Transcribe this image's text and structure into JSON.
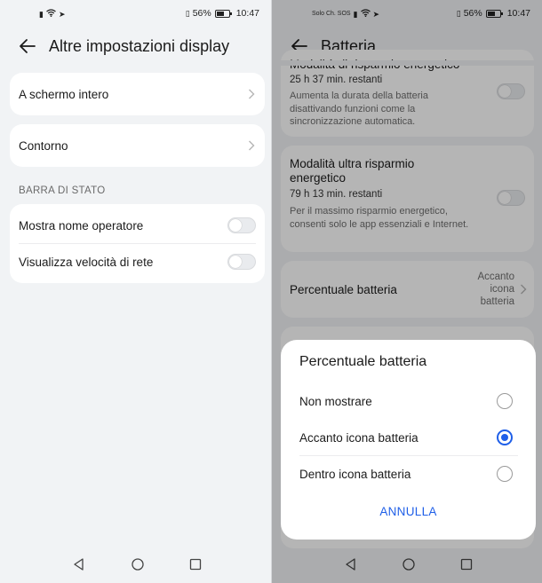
{
  "left": {
    "statusbar": {
      "battery": "56%",
      "time": "10:47"
    },
    "header": {
      "title": "Altre impostazioni display"
    },
    "items": [
      {
        "label": "A schermo intero"
      },
      {
        "label": "Contorno"
      }
    ],
    "section": {
      "title": "BARRA DI STATO"
    },
    "toggles": [
      {
        "label": "Mostra nome operatore",
        "on": false
      },
      {
        "label": "Visualizza velocità di rete",
        "on": false
      }
    ]
  },
  "right": {
    "statusbar": {
      "carrier": "Solo Ch. SOS",
      "battery": "56%",
      "time": "10:47"
    },
    "header": {
      "title": "Batteria"
    },
    "power_saving": {
      "title_partial": "Modalità di risparmio energetico",
      "remaining": "25 h 37 min. restanti",
      "description": "Aumenta la durata della batteria disattivando funzioni come la sincronizzazione automatica.",
      "on": false
    },
    "ultra_saving": {
      "title": "Modalità ultra risparmio energetico",
      "remaining": "79 h 13 min. restanti",
      "description": "Per il massimo risparmio energetico, consenti solo le app essenziali e Internet.",
      "on": false
    },
    "battery_percentage": {
      "label": "Percentuale batteria",
      "value": "Accanto icona batteria"
    },
    "dialog": {
      "title": "Percentuale batteria",
      "options": [
        {
          "label": "Non mostrare",
          "selected": false
        },
        {
          "label": "Accanto icona batteria",
          "selected": true
        },
        {
          "label": "Dentro icona batteria",
          "selected": false
        }
      ],
      "cancel_label": "ANNULLA"
    }
  },
  "colors": {
    "accent": "#1f5fe8",
    "background": "#f1f3f5",
    "card": "#ffffff"
  },
  "icons": [
    "back-arrow-icon",
    "chevron-right-icon",
    "nav-back-icon",
    "nav-home-icon",
    "nav-recents-icon",
    "wifi-icon",
    "vibrate-icon",
    "battery-icon"
  ]
}
